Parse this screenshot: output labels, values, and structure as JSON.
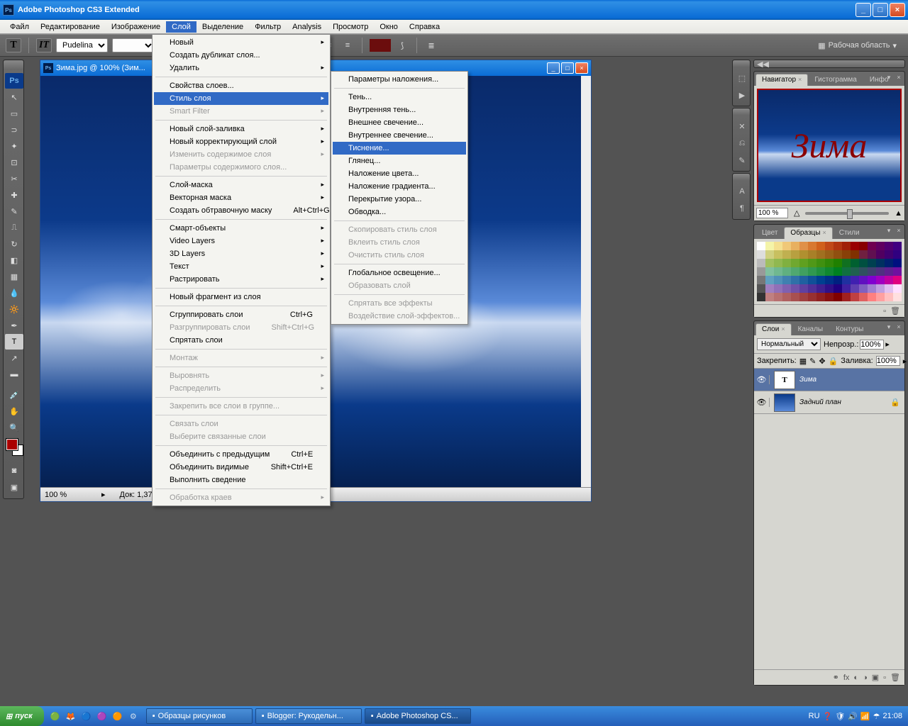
{
  "titlebar": {
    "title": "Adobe Photoshop CS3 Extended"
  },
  "menubar": [
    "Файл",
    "Редактирование",
    "Изображение",
    "Слой",
    "Выделение",
    "Фильтр",
    "Analysis",
    "Просмотр",
    "Окно",
    "Справка"
  ],
  "menubar_active_index": 3,
  "optbar": {
    "font_family": "Pudelina",
    "workspace_label": "Рабочая область"
  },
  "document": {
    "title": "Зима.jpg @ 100% (Зим...",
    "status_zoom": "100 %",
    "status_doc": "Док: 1,37M/1,71M"
  },
  "layer_menu": {
    "groups": [
      [
        {
          "label": "Новый",
          "arrow": true
        },
        {
          "label": "Создать дубликат слоя..."
        },
        {
          "label": "Удалить",
          "arrow": true
        }
      ],
      [
        {
          "label": "Свойства слоев..."
        },
        {
          "label": "Стиль слоя",
          "arrow": true,
          "highlighted": true
        },
        {
          "label": "Smart Filter",
          "arrow": true,
          "disabled": true
        }
      ],
      [
        {
          "label": "Новый слой-заливка",
          "arrow": true
        },
        {
          "label": "Новый корректирующий слой",
          "arrow": true
        },
        {
          "label": "Изменить содержимое слоя",
          "arrow": true,
          "disabled": true
        },
        {
          "label": "Параметры содержимого слоя...",
          "disabled": true
        }
      ],
      [
        {
          "label": "Слой-маска",
          "arrow": true
        },
        {
          "label": "Векторная маска",
          "arrow": true
        },
        {
          "label": "Создать обтравочную маску",
          "shortcut": "Alt+Ctrl+G"
        }
      ],
      [
        {
          "label": "Смарт-объекты",
          "arrow": true
        },
        {
          "label": "Video Layers",
          "arrow": true
        },
        {
          "label": "3D Layers",
          "arrow": true
        },
        {
          "label": "Текст",
          "arrow": true
        },
        {
          "label": "Растрировать",
          "arrow": true
        }
      ],
      [
        {
          "label": "Новый фрагмент из слоя"
        }
      ],
      [
        {
          "label": "Сгруппировать слои",
          "shortcut": "Ctrl+G"
        },
        {
          "label": "Разгруппировать слои",
          "shortcut": "Shift+Ctrl+G",
          "disabled": true
        },
        {
          "label": "Спрятать слои"
        }
      ],
      [
        {
          "label": "Монтаж",
          "arrow": true,
          "disabled": true
        }
      ],
      [
        {
          "label": "Выровнять",
          "arrow": true,
          "disabled": true
        },
        {
          "label": "Распределить",
          "arrow": true,
          "disabled": true
        }
      ],
      [
        {
          "label": "Закрепить все слои в группе...",
          "disabled": true
        }
      ],
      [
        {
          "label": "Связать слои",
          "disabled": true
        },
        {
          "label": "Выберите связанные слои",
          "disabled": true
        }
      ],
      [
        {
          "label": "Объединить с предыдущим",
          "shortcut": "Ctrl+E"
        },
        {
          "label": "Объединить видимые",
          "shortcut": "Shift+Ctrl+E"
        },
        {
          "label": "Выполнить сведение"
        }
      ],
      [
        {
          "label": "Обработка краев",
          "arrow": true,
          "disabled": true
        }
      ]
    ]
  },
  "style_submenu": {
    "groups": [
      [
        {
          "label": "Параметры наложения..."
        }
      ],
      [
        {
          "label": "Тень..."
        },
        {
          "label": "Внутренняя тень..."
        },
        {
          "label": "Внешнее свечение..."
        },
        {
          "label": "Внутреннее свечение..."
        },
        {
          "label": "Тиснение...",
          "highlighted": true
        },
        {
          "label": "Глянец..."
        },
        {
          "label": "Наложение цвета..."
        },
        {
          "label": "Наложение градиента..."
        },
        {
          "label": "Перекрытие узора..."
        },
        {
          "label": "Обводка..."
        }
      ],
      [
        {
          "label": "Скопировать стиль слоя",
          "disabled": true
        },
        {
          "label": "Вклеить стиль слоя",
          "disabled": true
        },
        {
          "label": "Очистить стиль слоя",
          "disabled": true
        }
      ],
      [
        {
          "label": "Глобальное освещение..."
        },
        {
          "label": "Образовать слой",
          "disabled": true
        }
      ],
      [
        {
          "label": "Спрятать все эффекты",
          "disabled": true
        },
        {
          "label": "Воздействие слой-эффектов...",
          "disabled": true
        }
      ]
    ]
  },
  "panels": {
    "navigator": {
      "tabs": [
        "Навигатор",
        "Гистограмма",
        "Инфо"
      ],
      "active": 0,
      "zoom": "100 %",
      "overlay_text": "Зима"
    },
    "swatches": {
      "tabs": [
        "Цвет",
        "Образцы",
        "Стили"
      ],
      "active": 1
    },
    "layers": {
      "tabs": [
        "Слои",
        "Каналы",
        "Контуры"
      ],
      "active": 0,
      "blend_mode": "Нормальный",
      "opacity_label": "Непрозр.:",
      "opacity": "100%",
      "lock_label": "Закрепить:",
      "fill_label": "Заливка:",
      "fill": "100%",
      "rows": [
        {
          "name": "Зима",
          "type": "T",
          "selected": true
        },
        {
          "name": "Задний план",
          "type": "img",
          "locked": true
        }
      ]
    }
  },
  "taskbar": {
    "start": "пуск",
    "tasks": [
      {
        "label": "Образцы рисунков"
      },
      {
        "label": "Blogger: Рукодельн..."
      },
      {
        "label": "Adobe Photoshop CS...",
        "active": true
      }
    ],
    "lang": "RU",
    "clock": "21:08"
  },
  "swatch_colors": [
    "#fff",
    "#f4f4a8",
    "#f4e090",
    "#f0c878",
    "#e8b060",
    "#e09048",
    "#d87830",
    "#d0601c",
    "#c04818",
    "#b03410",
    "#a02008",
    "#900",
    "#800",
    "#700050",
    "#600060",
    "#500070",
    "#400080",
    "#ddd",
    "#d0d080",
    "#c8c060",
    "#c0b050",
    "#b8a040",
    "#b09030",
    "#a88028",
    "#a07020",
    "#986018",
    "#905010",
    "#884008",
    "#803000",
    "#702040",
    "#601050",
    "#500060",
    "#400070",
    "#300080",
    "#bbb",
    "#a0c060",
    "#90b850",
    "#80b040",
    "#70a830",
    "#60a020",
    "#509818",
    "#409010",
    "#308808",
    "#208000",
    "#107020",
    "#006030",
    "#005040",
    "#004050",
    "#003060",
    "#002070",
    "#001080",
    "#999",
    "#80c0a0",
    "#70b890",
    "#60b080",
    "#50a870",
    "#40a060",
    "#309850",
    "#209040",
    "#108830",
    "#008020",
    "#107040",
    "#206050",
    "#305060",
    "#404070",
    "#503080",
    "#602090",
    "#7010a0",
    "#777",
    "#60a0c0",
    "#5090b8",
    "#4080b0",
    "#3070a8",
    "#2060a0",
    "#105098",
    "#004090",
    "#003088",
    "#002080",
    "#2030a0",
    "#4020b0",
    "#6010c0",
    "#8000d0",
    "#a000c0",
    "#c000a0",
    "#e00080",
    "#555",
    "#a080c0",
    "#9070b8",
    "#8060b0",
    "#7050a8",
    "#6040a0",
    "#503098",
    "#402090",
    "#301088",
    "#200080",
    "#4020a0",
    "#6040b0",
    "#8060c0",
    "#a080d0",
    "#c0a0e0",
    "#e0c0f0",
    "#ffe0ff",
    "#333",
    "#c08080",
    "#b87070",
    "#b06060",
    "#a85050",
    "#a04040",
    "#983030",
    "#902020",
    "#881010",
    "#800000",
    "#a02020",
    "#c04040",
    "#e06060",
    "#ff8080",
    "#ffa0a0",
    "#ffc0c0",
    "#ffe0e0"
  ]
}
